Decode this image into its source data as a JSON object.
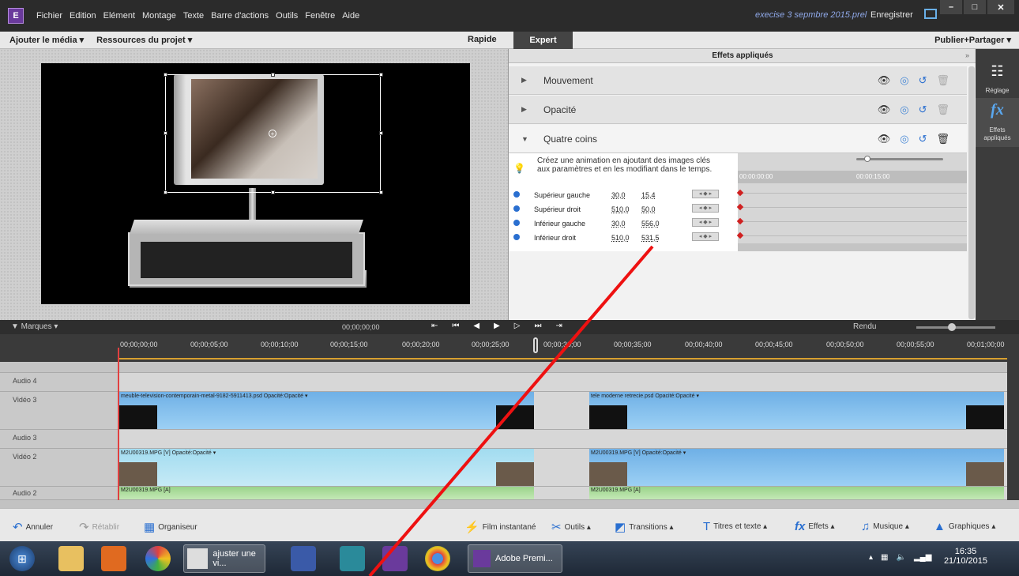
{
  "app": {
    "menu": [
      "Fichier",
      "Edition",
      "Elément",
      "Montage",
      "Texte",
      "Barre d'actions",
      "Outils",
      "Fenêtre",
      "Aide"
    ],
    "project_title": "execise 3 sepmbre 2015.prel",
    "save_label": "Enregistrer"
  },
  "modebar": {
    "add_media": "Ajouter le média ▾",
    "project_assets": "Ressources du projet ▾",
    "rapide": "Rapide",
    "expert": "Expert",
    "publish": "Publier+Partager ▾"
  },
  "effects_panel": {
    "title": "Effets appliqués",
    "effects": [
      {
        "name": "Mouvement",
        "expanded": false
      },
      {
        "name": "Opacité",
        "expanded": false
      },
      {
        "name": "Quatre coins",
        "expanded": true
      }
    ],
    "info_text": "Créez une animation en ajoutant des images clés aux paramètres et en les modifiant dans le temps.",
    "kf_ruler": [
      "00:00:00:00",
      "00:00:15:00"
    ],
    "params": [
      {
        "label": "Supérieur gauche",
        "v1": "30,0",
        "v2": "15,4"
      },
      {
        "label": "Supérieur droit",
        "v1": "510,0",
        "v2": "50,0"
      },
      {
        "label": "Inférieur gauche",
        "v1": "30,0",
        "v2": "556,0"
      },
      {
        "label": "Inférieur droit",
        "v1": "510,0",
        "v2": "531,5"
      }
    ]
  },
  "sidebar": {
    "reglage": "Réglage",
    "effets": "Effets appliqués"
  },
  "timeline": {
    "marques": "▼ Marques  ▾",
    "timecode": "00;00;00;00",
    "rendu": "Rendu",
    "ruler": [
      "00;00;00;00",
      "00;00;05;00",
      "00;00;10;00",
      "00;00;15;00",
      "00;00;20;00",
      "00;00;25;00",
      "00;00;30;00",
      "00;00;35;00",
      "00;00;40;00",
      "00;00;45;00",
      "00;00;50;00",
      "00;00;55;00",
      "00;01;00;00"
    ],
    "tracks": {
      "audio4": "Audio 4",
      "video3": "Vidéo 3",
      "audio3": "Audio 3",
      "video2": "Vidéo 2",
      "audio2": "Audio 2"
    },
    "clips": {
      "v3a": "meuble-television-contemporain-metal-9182-5911413.psd  Opacité:Opacité ▾",
      "v3b": "tele moderne retrecie.psd  Opacité:Opacité ▾",
      "v2a": "M2U00319.MPG [V]  Opacité:Opacité ▾",
      "v2b": "M2U00319.MPG [V]  Opacité:Opacité ▾",
      "a2a": "M2U00319.MPG [A]",
      "a2b": "M2U00319.MPG [A]"
    }
  },
  "toolbar": {
    "annuler": "Annuler",
    "retablir": "Rétablir",
    "organiseur": "Organiseur",
    "film": "Film instantané",
    "outils": "Outils  ▴",
    "transitions": "Transitions  ▴",
    "titres": "Titres et texte  ▴",
    "effets": "Effets  ▴",
    "musique": "Musique  ▴",
    "graphiques": "Graphiques  ▴"
  },
  "taskbar": {
    "win1": "ajuster une vi...",
    "win2": "Adobe Premi...",
    "time": "16:35",
    "date": "21/10/2015"
  }
}
